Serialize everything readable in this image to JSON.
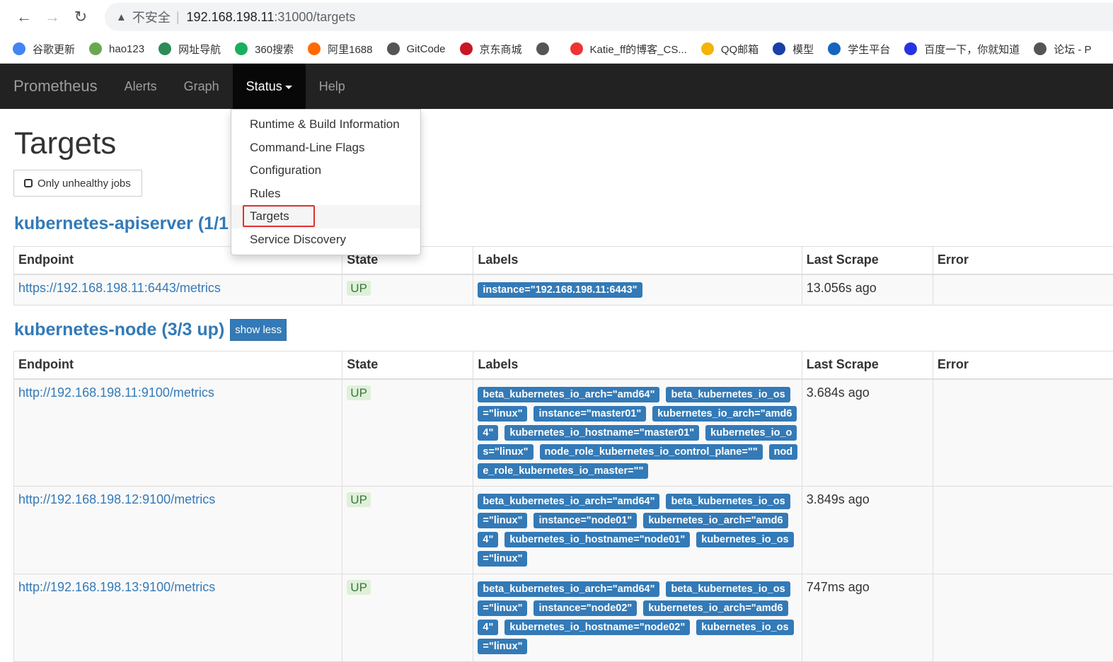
{
  "browser": {
    "insecure": "不安全",
    "url_host": "192.168.198.11",
    "url_rest": ":31000/targets",
    "bookmarks": [
      {
        "label": "谷歌更新",
        "color": "#4285f4"
      },
      {
        "label": "hao123",
        "color": "#6aa84f"
      },
      {
        "label": "网址导航",
        "color": "#2e8b57"
      },
      {
        "label": "360搜索",
        "color": "#1aaf5d"
      },
      {
        "label": "阿里1688",
        "color": "#ff6a00"
      },
      {
        "label": "GitCode",
        "color": "#555"
      },
      {
        "label": "京东商城",
        "color": "#c91623"
      },
      {
        "label": "",
        "color": "#555"
      },
      {
        "label": "Katie_ff的博客_CS...",
        "color": "#e33"
      },
      {
        "label": "QQ邮箱",
        "color": "#f4b400"
      },
      {
        "label": "模型",
        "color": "#1a3fa8"
      },
      {
        "label": "学生平台",
        "color": "#1565c0"
      },
      {
        "label": "百度一下，你就知道",
        "color": "#2932e1"
      },
      {
        "label": "论坛 - P",
        "color": "#555"
      }
    ]
  },
  "nav": {
    "brand": "Prometheus",
    "items": [
      "Alerts",
      "Graph",
      "Status",
      "Help"
    ]
  },
  "status_menu": [
    "Runtime & Build Information",
    "Command-Line Flags",
    "Configuration",
    "Rules",
    "Targets",
    "Service Discovery"
  ],
  "page": {
    "title": "Targets",
    "filter_label": "Only unhealthy jobs"
  },
  "columns": [
    "Endpoint",
    "State",
    "Labels",
    "Last Scrape",
    "Error"
  ],
  "jobs": [
    {
      "title": "kubernetes-apiserver (1/1",
      "targets": [
        {
          "endpoint": "https://192.168.198.11:6443/metrics",
          "state": "UP",
          "labels": [
            "instance=\"192.168.198.11:6443\""
          ],
          "last_scrape": "13.056s ago",
          "error": ""
        }
      ]
    },
    {
      "title": "kubernetes-node (3/3 up)",
      "show_less": "show less",
      "targets": [
        {
          "endpoint": "http://192.168.198.11:9100/metrics",
          "state": "UP",
          "labels": [
            "beta_kubernetes_io_arch=\"amd64\"",
            "beta_kubernetes_io_os=\"linux\"",
            "instance=\"master01\"",
            "kubernetes_io_arch=\"amd64\"",
            "kubernetes_io_hostname=\"master01\"",
            "kubernetes_io_os=\"linux\"",
            "node_role_kubernetes_io_control_plane=\"\"",
            "node_role_kubernetes_io_master=\"\""
          ],
          "last_scrape": "3.684s ago",
          "error": ""
        },
        {
          "endpoint": "http://192.168.198.12:9100/metrics",
          "state": "UP",
          "labels": [
            "beta_kubernetes_io_arch=\"amd64\"",
            "beta_kubernetes_io_os=\"linux\"",
            "instance=\"node01\"",
            "kubernetes_io_arch=\"amd64\"",
            "kubernetes_io_hostname=\"node01\"",
            "kubernetes_io_os=\"linux\""
          ],
          "last_scrape": "3.849s ago",
          "error": ""
        },
        {
          "endpoint": "http://192.168.198.13:9100/metrics",
          "state": "UP",
          "labels": [
            "beta_kubernetes_io_arch=\"amd64\"",
            "beta_kubernetes_io_os=\"linux\"",
            "instance=\"node02\"",
            "kubernetes_io_arch=\"amd64\"",
            "kubernetes_io_hostname=\"node02\"",
            "kubernetes_io_os=\"linux\""
          ],
          "last_scrape": "747ms ago",
          "error": ""
        }
      ]
    }
  ]
}
